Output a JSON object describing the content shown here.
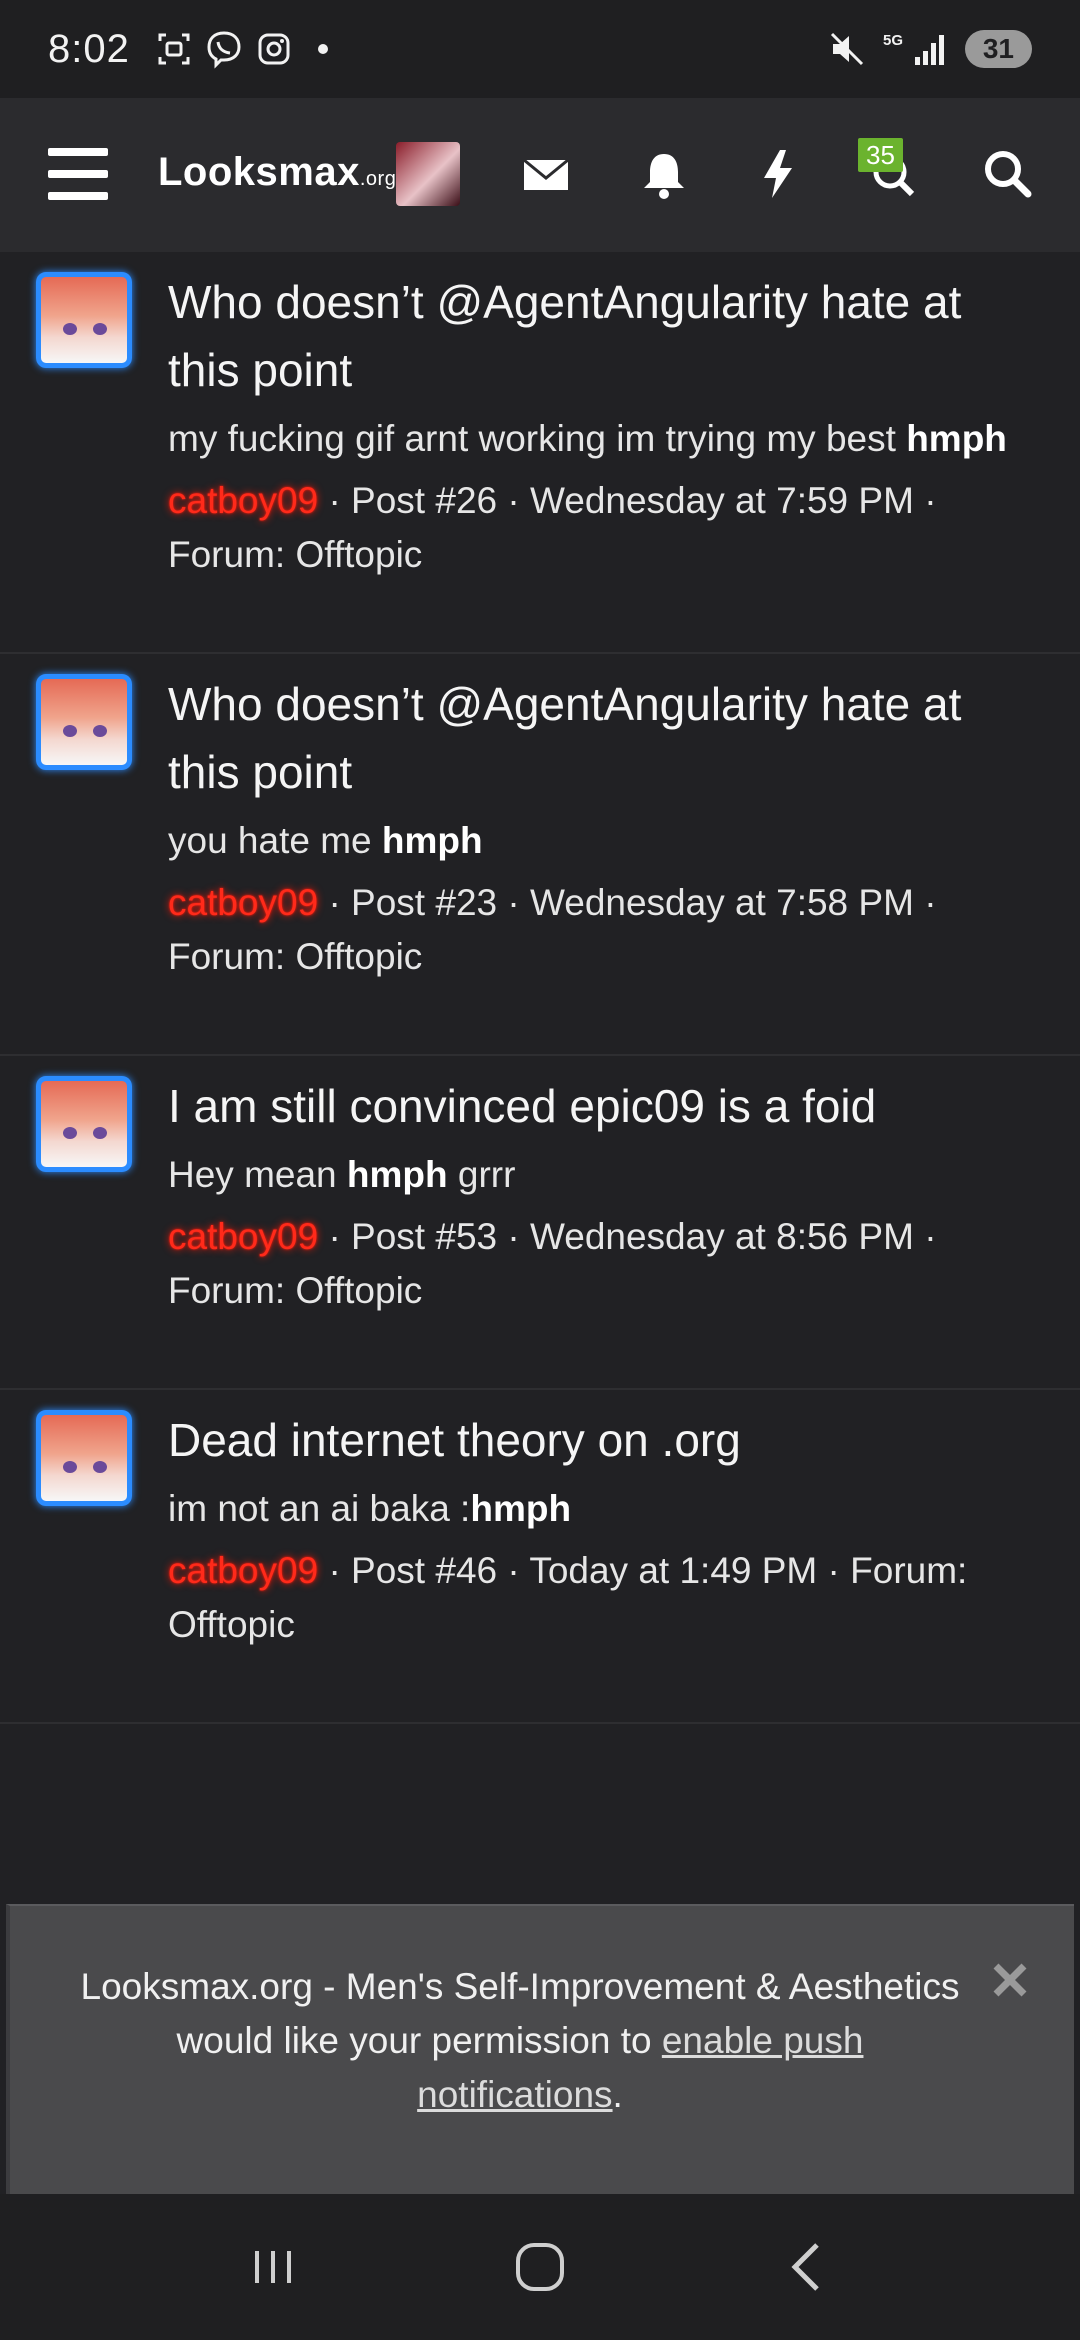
{
  "status_bar": {
    "time": "8:02",
    "network": "5G",
    "battery": "31"
  },
  "header": {
    "logo_main": "Looksmax",
    "logo_suffix": ".org",
    "notifications_badge": "35"
  },
  "results": [
    {
      "title": "Who doesn’t @AgentAngularity hate at this point",
      "snippet_text": "my fucking gif arnt working im trying my best ",
      "snippet_bold": "hmph",
      "snippet_tail": "",
      "username": "catboy09",
      "meta": " · Post #26 · Wednesday at 7:59 PM · Forum: Offtopic"
    },
    {
      "title": "Who doesn’t @AgentAngularity hate at this point",
      "snippet_text": "you hate me ",
      "snippet_bold": "hmph",
      "snippet_tail": "",
      "username": "catboy09",
      "meta": " · Post #23 · Wednesday at 7:58 PM · Forum: Offtopic"
    },
    {
      "title": "I am still convinced epic09 is a foid",
      "snippet_text": "Hey mean ",
      "snippet_bold": "hmph",
      "snippet_tail": " grrr",
      "username": "catboy09",
      "meta": " · Post #53 · Wednesday at 8:56 PM · Forum: Offtopic"
    },
    {
      "title": "Dead internet theory on .org",
      "snippet_text": "im not an ai baka :",
      "snippet_bold": "hmph",
      "snippet_tail": "",
      "username": "catboy09",
      "meta": " · Post #46 · Today at 1:49 PM · Forum: Offtopic"
    }
  ],
  "push_prompt": {
    "text": "Looksmax.org - Men's Self-Improvement & Aesthetics would like your permission to ",
    "link": "enable push notifications",
    "tail": "."
  }
}
